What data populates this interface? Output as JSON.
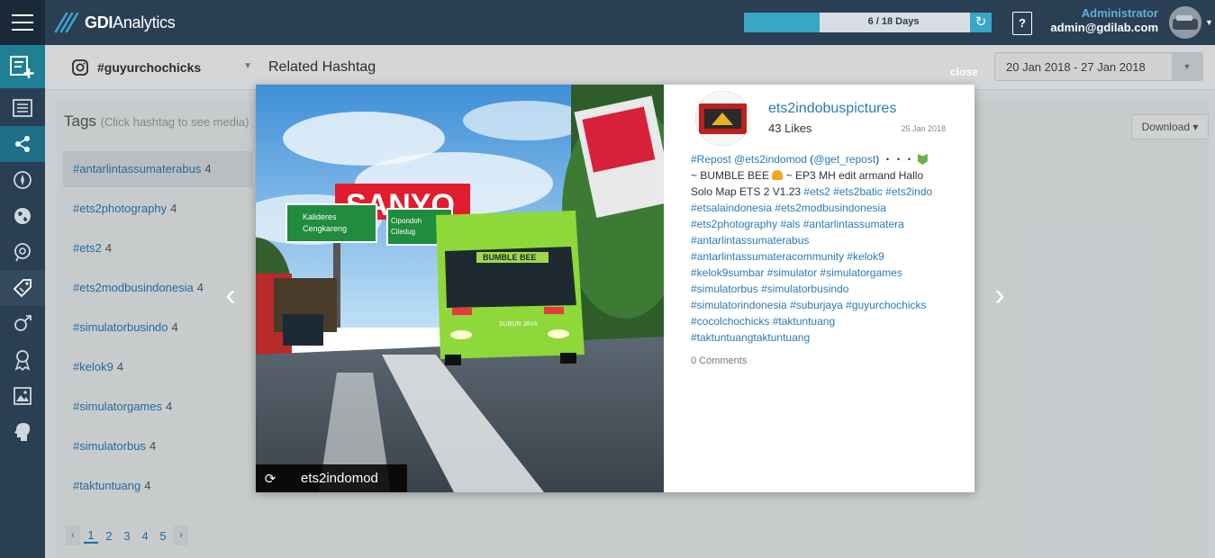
{
  "header": {
    "logo_text_bold": "GDI",
    "logo_text": "Analytics",
    "progress_label": "6 / 18 Days",
    "progress_fraction": 0.333,
    "help_label": "?",
    "user_role": "Administrator",
    "user_email": "admin@gdilab.com"
  },
  "sidebar": {
    "icons": [
      "add-report-icon",
      "list-icon",
      "share-icon",
      "compass-icon",
      "globe-icon",
      "chat-search-icon",
      "tag-icon",
      "gender-icon",
      "influencer-icon",
      "image-icon",
      "brain-icon"
    ]
  },
  "filter": {
    "hashtag": "#guyurchochicks",
    "page_title": "Related Hashtag",
    "date_range": "20 Jan 2018 - 27 Jan 2018",
    "download_label": "Download"
  },
  "tags": {
    "title": "Tags",
    "hint": "(Click hashtag to see media)",
    "items": [
      {
        "tag": "#antarlintassumaterabus",
        "count": "4"
      },
      {
        "tag": "#ets2photography",
        "count": "4"
      },
      {
        "tag": "#ets2",
        "count": "4"
      },
      {
        "tag": "#ets2modbusindonesia",
        "count": "4"
      },
      {
        "tag": "#simulatorbusindo",
        "count": "4"
      },
      {
        "tag": "#kelok9",
        "count": "4"
      },
      {
        "tag": "#simulatorgames",
        "count": "4"
      },
      {
        "tag": "#simulatorbus",
        "count": "4"
      },
      {
        "tag": "#taktuntuang",
        "count": "4"
      }
    ],
    "pages": [
      "1",
      "2",
      "3",
      "4",
      "5"
    ]
  },
  "modal": {
    "close_label": "close",
    "prev_arrow": "‹",
    "next_arrow": "›",
    "repost_user": "ets2indomod",
    "account_name": "ets2indobuspictures",
    "likes": "43 Likes",
    "date": "25 Jan 2018",
    "caption": {
      "l1a": "#Repost",
      "l1b": "@ets2indomod",
      "l1c": " (",
      "l1d": "@get_repost",
      "l1e": ") ・・・ ",
      "l2a": "~ BUMBLE BEE ",
      "l2b": " ~ EP3 MH edit armand Hallo",
      "l3a": "Solo Map ETS 2 V1.23 ",
      "l3b": "#ets2",
      "l3c": "#ets2batic",
      "l3d": "#ets2indo",
      "l4a": "#etsalaindonesia",
      "l4b": "#ets2modbusindonesia",
      "l5a": "#ets2photography",
      "l5b": "#als",
      "l5c": "#antarlintassumatera",
      "l6": "#antarlintassumaterabus",
      "l7a": "#antarlintassumateracommunity",
      "l7b": "#kelok9",
      "l8a": "#kelok9sumbar",
      "l8b": "#simulator",
      "l8c": "#simulatorgames",
      "l9a": "#simulatorbus",
      "l9b": "#simulatorbusindo",
      "l10a": "#simulatorindonesia",
      "l10b": "#suburjaya",
      "l10c": "#guyurchochicks",
      "l11a": "#cocolchochicks",
      "l11b": "#taktuntuang",
      "l12": "#taktuntuangtaktuntuang"
    },
    "comments": "0 Comments",
    "photo_signs": {
      "billboard": "SANYO",
      "sign_left_1": "Kalideres",
      "sign_left_2": "Cengkareng",
      "sign_right_1": "Cipondoh",
      "sign_right_2": "Ciledug",
      "bus_banner": "BUMBLE BEE",
      "bus_label": "SUBUR JAYA"
    }
  }
}
